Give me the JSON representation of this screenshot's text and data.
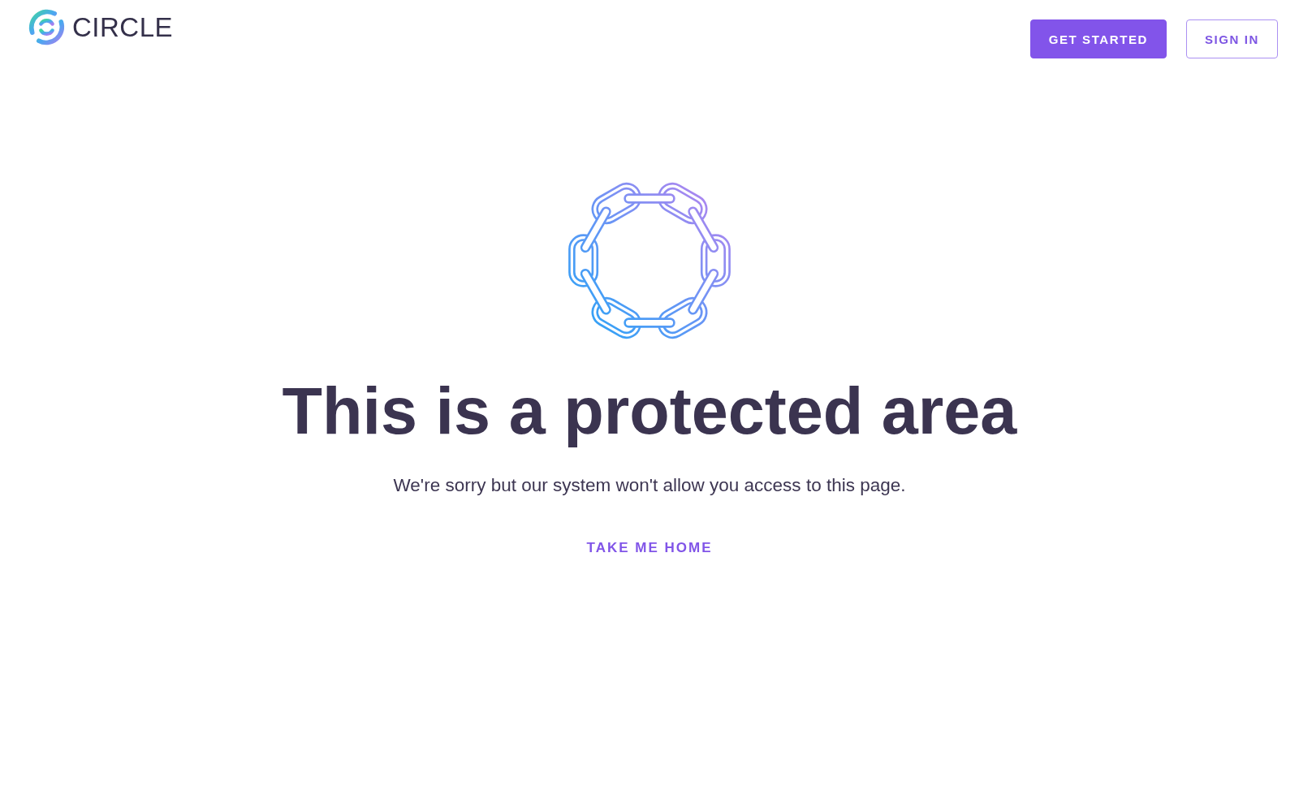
{
  "header": {
    "logo_text": "CIRCLE",
    "buttons": [
      {
        "label": "GET STARTED",
        "kind": "primary"
      },
      {
        "label": "SIGN IN",
        "kind": "outline"
      }
    ]
  },
  "main": {
    "heading": "This is a protected area",
    "message": "We're sorry but our system won't allow you access to this page.",
    "link": "TAKE ME HOME"
  }
}
